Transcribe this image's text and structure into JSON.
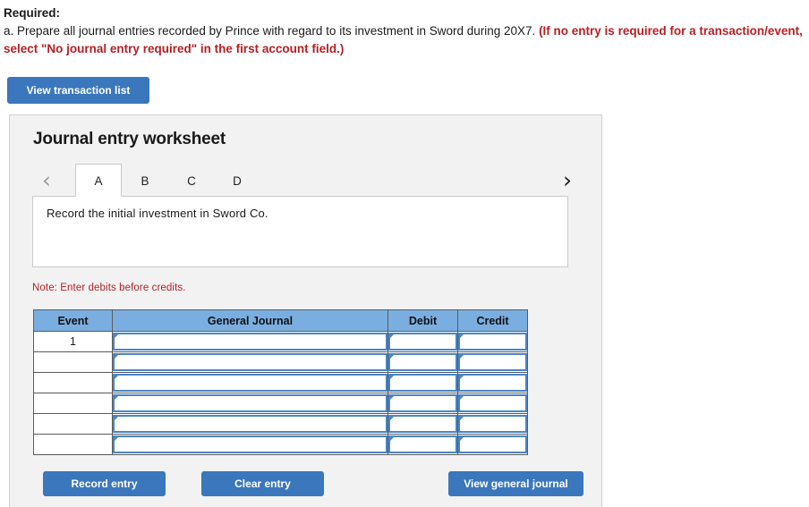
{
  "requirement": {
    "title": "Required:",
    "body_plain": "a. Prepare all journal entries recorded by Prince with regard to its investment in Sword during 20X7. ",
    "body_emphasis": "(If no entry is required for a transaction/event, select \"No journal entry required\" in the first account field.)"
  },
  "toolbar": {
    "view_transaction_list_label": "View transaction list"
  },
  "worksheet": {
    "title": "Journal entry worksheet",
    "prev_arrow": "‹",
    "next_arrow": "›",
    "tabs": [
      {
        "label": "A",
        "active": true
      },
      {
        "label": "B",
        "active": false
      },
      {
        "label": "C",
        "active": false
      },
      {
        "label": "D",
        "active": false
      }
    ],
    "description": "Record the initial investment in Sword Co.",
    "note": "Note: Enter debits before credits."
  },
  "table": {
    "headers": [
      "Event",
      "General Journal",
      "Debit",
      "Credit"
    ],
    "rows": [
      {
        "event": "1",
        "journal": "",
        "debit": "",
        "credit": ""
      },
      {
        "event": "",
        "journal": "",
        "debit": "",
        "credit": ""
      },
      {
        "event": "",
        "journal": "",
        "debit": "",
        "credit": ""
      },
      {
        "event": "",
        "journal": "",
        "debit": "",
        "credit": ""
      },
      {
        "event": "",
        "journal": "",
        "debit": "",
        "credit": ""
      },
      {
        "event": "",
        "journal": "",
        "debit": "",
        "credit": ""
      }
    ]
  },
  "actions": {
    "record_entry_label": "Record entry",
    "clear_entry_label": "Clear entry",
    "view_general_journal_label": "View general journal"
  },
  "colors": {
    "button_blue": "#3a77bc",
    "table_header_blue": "#7aaee0",
    "input_border_blue": "#4a86c5",
    "emphasis_red": "#b61f24",
    "panel_gray": "#f2f2f2"
  }
}
